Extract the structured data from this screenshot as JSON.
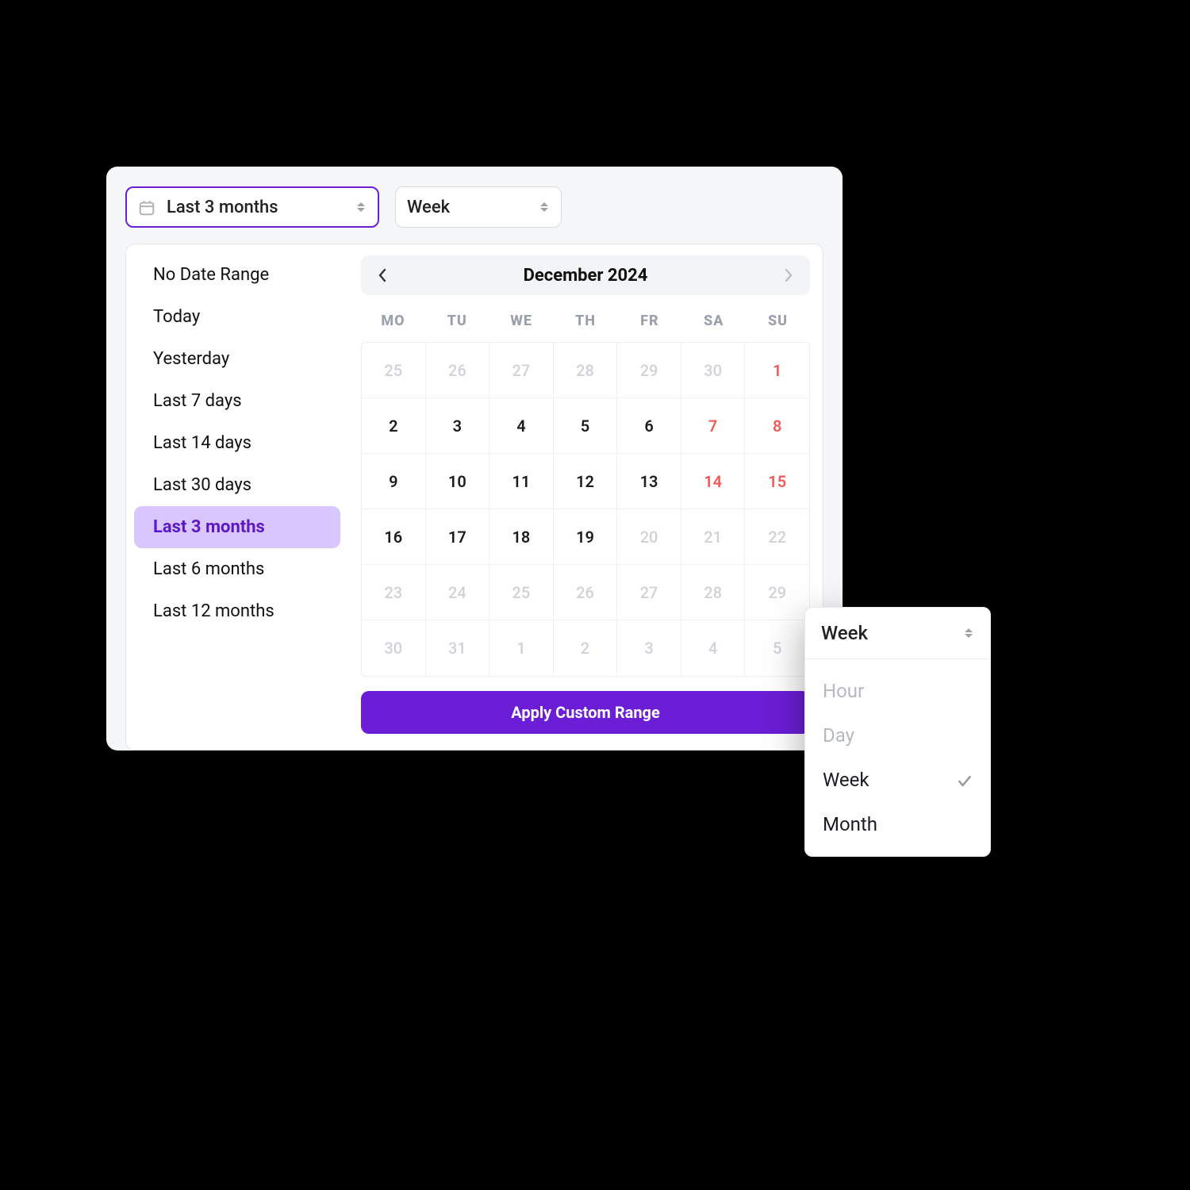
{
  "colors": {
    "accent": "#6b1ed6",
    "accent_light": "#d9c6ff",
    "weekend": "#f15b5b"
  },
  "controls": {
    "range_selector_label": "Last 3 months",
    "group_selector_label": "Week"
  },
  "presets": [
    {
      "label": "No Date Range",
      "selected": false
    },
    {
      "label": "Today",
      "selected": false
    },
    {
      "label": "Yesterday",
      "selected": false
    },
    {
      "label": "Last 7 days",
      "selected": false
    },
    {
      "label": "Last 14 days",
      "selected": false
    },
    {
      "label": "Last 30 days",
      "selected": false
    },
    {
      "label": "Last 3 months",
      "selected": true
    },
    {
      "label": "Last 6 months",
      "selected": false
    },
    {
      "label": "Last 12 months",
      "selected": false
    }
  ],
  "calendar": {
    "month_title": "December 2024",
    "prev_enabled": true,
    "next_enabled": false,
    "dow": [
      "MO",
      "TU",
      "WE",
      "TH",
      "FR",
      "SA",
      "SU"
    ],
    "weeks": [
      [
        {
          "d": "25",
          "out": true
        },
        {
          "d": "26",
          "out": true
        },
        {
          "d": "27",
          "out": true
        },
        {
          "d": "28",
          "out": true
        },
        {
          "d": "29",
          "out": true
        },
        {
          "d": "30",
          "out": true
        },
        {
          "d": "1",
          "weekend": true
        }
      ],
      [
        {
          "d": "2"
        },
        {
          "d": "3"
        },
        {
          "d": "4"
        },
        {
          "d": "5"
        },
        {
          "d": "6"
        },
        {
          "d": "7",
          "weekend": true
        },
        {
          "d": "8",
          "weekend": true
        }
      ],
      [
        {
          "d": "9"
        },
        {
          "d": "10"
        },
        {
          "d": "11"
        },
        {
          "d": "12"
        },
        {
          "d": "13"
        },
        {
          "d": "14",
          "weekend": true
        },
        {
          "d": "15",
          "weekend": true
        }
      ],
      [
        {
          "d": "16"
        },
        {
          "d": "17"
        },
        {
          "d": "18"
        },
        {
          "d": "19"
        },
        {
          "d": "20",
          "out": true
        },
        {
          "d": "21",
          "out": true
        },
        {
          "d": "22",
          "out": true
        }
      ],
      [
        {
          "d": "23",
          "out": true
        },
        {
          "d": "24",
          "out": true
        },
        {
          "d": "25",
          "out": true
        },
        {
          "d": "26",
          "out": true
        },
        {
          "d": "27",
          "out": true
        },
        {
          "d": "28",
          "out": true
        },
        {
          "d": "29",
          "out": true
        }
      ],
      [
        {
          "d": "30",
          "out": true
        },
        {
          "d": "31",
          "out": true
        },
        {
          "d": "1",
          "out": true
        },
        {
          "d": "2",
          "out": true
        },
        {
          "d": "3",
          "out": true
        },
        {
          "d": "4",
          "out": true
        },
        {
          "d": "5",
          "out": true
        }
      ]
    ],
    "apply_label": "Apply Custom Range"
  },
  "dropdown": {
    "header": "Week",
    "items": [
      {
        "label": "Hour",
        "faded": true,
        "checked": false
      },
      {
        "label": "Day",
        "faded": true,
        "checked": false
      },
      {
        "label": "Week",
        "faded": false,
        "checked": true
      },
      {
        "label": "Month",
        "faded": false,
        "checked": false
      }
    ]
  }
}
